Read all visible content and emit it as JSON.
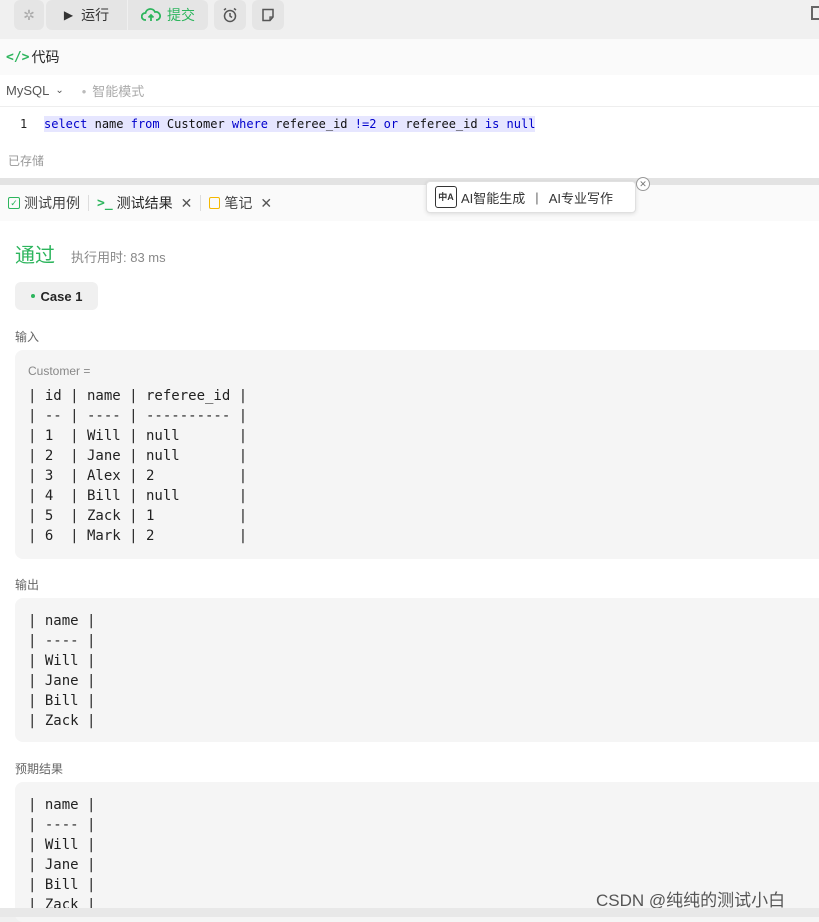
{
  "toolbar": {
    "run_label": "运行",
    "submit_label": "提交"
  },
  "code": {
    "header_icon": "</>",
    "header_title": "代码",
    "language": "MySQL",
    "mode": "智能模式",
    "line_number": "1",
    "tokens": {
      "t1": "select",
      "t2": "name",
      "t3": "from",
      "t4": "Customer",
      "t5": "where",
      "t6": "referee_id",
      "t7": "!=2",
      "t8": "or",
      "t9": "referee_id",
      "t10": "is",
      "t11": "null"
    },
    "saved_status": "已存储"
  },
  "tabs": [
    {
      "label": "测试用例"
    },
    {
      "label": "测试结果"
    },
    {
      "label": "笔记"
    }
  ],
  "ai_popup": {
    "logo_text_top": "中",
    "logo_text_bottom": "A",
    "item1": "AI智能生成",
    "separator": "|",
    "item2": "AI专业写作"
  },
  "result": {
    "status": "通过",
    "exec_time": "执行用时: 83 ms",
    "case_label": "Case 1",
    "input_label": "输入",
    "input_var": "Customer =",
    "input_table": [
      "| id | name | referee_id |",
      "| -- | ---- | ---------- |",
      "| 1  | Will | null       |",
      "| 2  | Jane | null       |",
      "| 3  | Alex | 2          |",
      "| 4  | Bill | null       |",
      "| 5  | Zack | 1          |",
      "| 6  | Mark | 2          |"
    ],
    "output_label": "输出",
    "output_table": [
      "| name |",
      "| ---- |",
      "| Will |",
      "| Jane |",
      "| Bill |",
      "| Zack |"
    ],
    "expected_label": "预期结果",
    "expected_table": [
      "| name |",
      "| ---- |",
      "| Will |",
      "| Jane |",
      "| Bill |",
      "| Zack |"
    ]
  },
  "watermark": "CSDN @纯纯的测试小白"
}
